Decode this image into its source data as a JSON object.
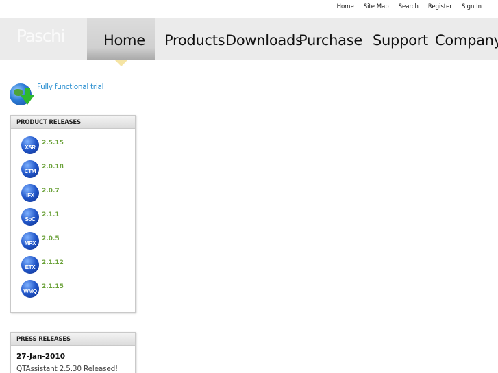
{
  "utility_links": [
    "Home",
    "Site Map",
    "Search",
    "Register",
    "Sign In"
  ],
  "brand": {
    "logo": "Paschi"
  },
  "nav": {
    "home": "Home",
    "products": "Products",
    "downloads": "Downloads",
    "purchase": "Purchase",
    "support": "Support",
    "company": "Company"
  },
  "trial": {
    "label": "Fully functional trial",
    "icon": "globe-download-icon"
  },
  "product_releases": {
    "title": "PRODUCT RELEASES",
    "items": [
      {
        "badge": "XSR",
        "version": "2.5.15"
      },
      {
        "badge": "CTM",
        "version": "2.0.18"
      },
      {
        "badge": "IFX",
        "version": "2.0.7"
      },
      {
        "badge": "SoC",
        "version": "2.1.1"
      },
      {
        "badge": "MPX",
        "version": "2.0.5"
      },
      {
        "badge": "ETX",
        "version": "2.1.12"
      },
      {
        "badge": "WMQ",
        "version": "2.1.15"
      }
    ]
  },
  "press_releases": {
    "title": "PRESS RELEASES",
    "date": "27-Jan-2010",
    "headline": "QTAssistant 2.5.30 Released!"
  },
  "colors": {
    "accent": "#2a8fd0",
    "version_green": "#6aa138",
    "nav_bg": "#ebebeb"
  }
}
